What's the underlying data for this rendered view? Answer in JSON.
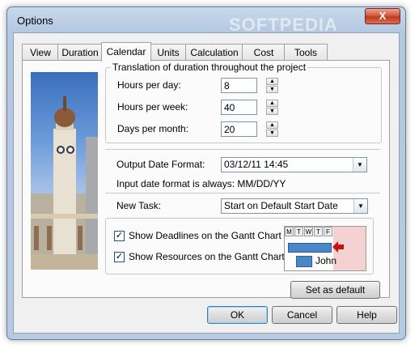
{
  "window": {
    "title": "Options",
    "close_glyph": "X",
    "watermark": "SOFTPEDIA"
  },
  "tabs": [
    {
      "label": "View"
    },
    {
      "label": "Duration"
    },
    {
      "label": "Calendar"
    },
    {
      "label": "Units"
    },
    {
      "label": "Calculation"
    },
    {
      "label": "Cost"
    },
    {
      "label": "Tools"
    }
  ],
  "active_tab": "Calendar",
  "translation": {
    "group_label": "Translation of duration throughout the project",
    "hours_per_day": {
      "label": "Hours per day:",
      "value": "8"
    },
    "hours_per_week": {
      "label": "Hours per week:",
      "value": "40"
    },
    "days_per_month": {
      "label": "Days per month:",
      "value": "20"
    }
  },
  "output_date": {
    "label": "Output Date Format:",
    "value": "03/12/11 14:45"
  },
  "input_note": "Input date format is always: MM/DD/YY",
  "new_task": {
    "label": "New Task:",
    "value": "Start on Default Start Date"
  },
  "options": {
    "show_deadlines": {
      "label": "Show Deadlines on the Gantt Chart",
      "checked": true
    },
    "show_resources": {
      "label": "Show Resources on the Gantt Chart",
      "checked": true
    }
  },
  "gantt_preview": {
    "days": [
      "M",
      "T",
      "W",
      "T",
      "F"
    ],
    "resource": "John"
  },
  "buttons": {
    "set_default": "Set as default",
    "ok": "OK",
    "cancel": "Cancel",
    "help": "Help"
  },
  "colors": {
    "accent": "#3c7fb1",
    "gantt_bar": "#4a86c8",
    "deadline_arrow": "#cc1111",
    "close_button": "#c0391f"
  }
}
